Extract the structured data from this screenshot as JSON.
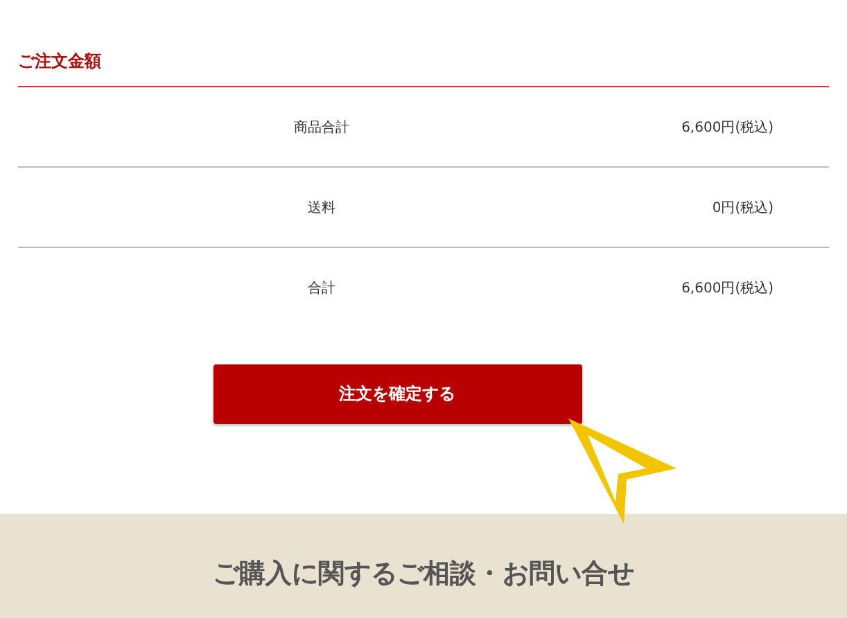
{
  "section": {
    "title": "ご注文金額"
  },
  "rows": [
    {
      "label": "商品合計",
      "value": "6,600円(税込)"
    },
    {
      "label": "送料",
      "value": "0円(税込)"
    },
    {
      "label": "合計",
      "value": "6,600円(税込)"
    }
  ],
  "confirm_button": {
    "label": "注文を確定する"
  },
  "contact_banner": {
    "title": "ご購入に関するご相談・お問い合せ"
  }
}
